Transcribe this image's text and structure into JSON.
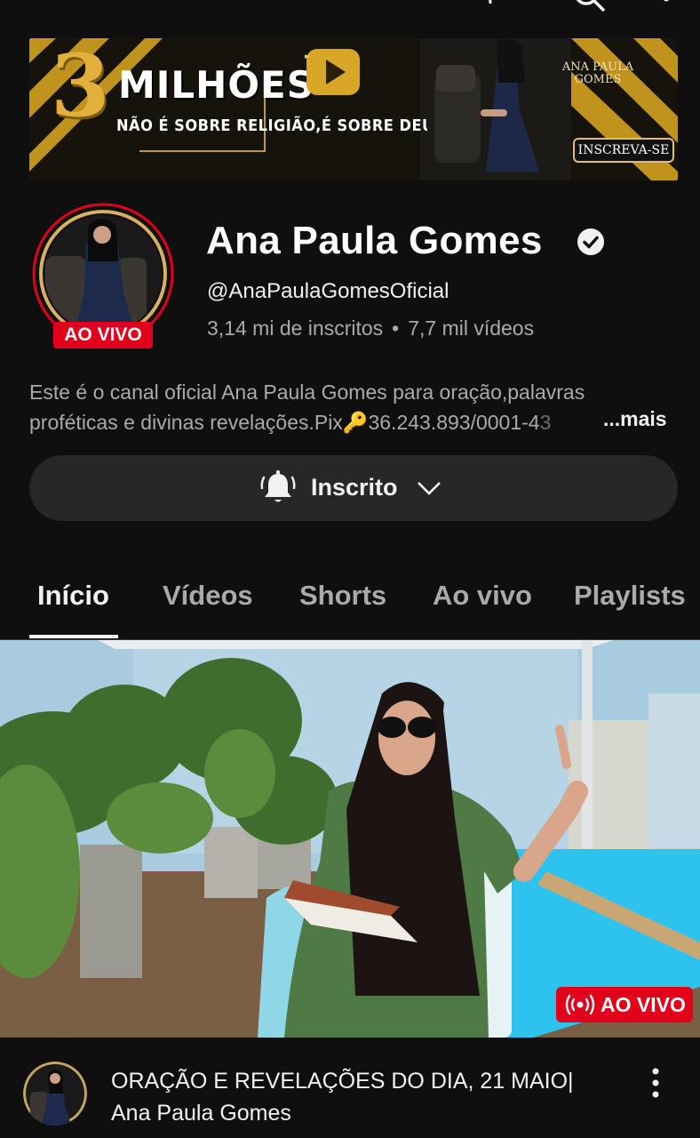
{
  "banner": {
    "big_number": "3",
    "headline": "MILHÕES",
    "tagline": "NÃO É SOBRE RELIGIÃO,É SOBRE DEUS.",
    "name_line1": "ANA PAULA",
    "name_line2": "GOMES",
    "cta": "INSCREVA-SE"
  },
  "channel": {
    "name": "Ana Paula Gomes",
    "handle": "@AnaPaulaGomesOficial",
    "subscribers": "3,14 mi de inscritos",
    "separator": "•",
    "videos": "7,7 mil vídeos",
    "live_badge": "AO VIVO",
    "description_line1": "Este é o canal oficial Ana Paula Gomes para oração,palavras",
    "description_line2": "proféticas e divinas revelações.Pix🔑36.243.893/0001-4",
    "description_fade": "3",
    "more": "...mais"
  },
  "subscribe": {
    "label": "Inscrito"
  },
  "tabs": [
    {
      "label": "Início",
      "active": true
    },
    {
      "label": "Vídeos",
      "active": false
    },
    {
      "label": "Shorts",
      "active": false
    },
    {
      "label": "Ao vivo",
      "active": false
    },
    {
      "label": "Playlists",
      "active": false
    }
  ],
  "video": {
    "live_label": "AO VIVO",
    "title_line1": "ORAÇÃO E REVELAÇÕES DO DIA, 21 MAIO|",
    "title_line2": "Ana Paula Gomes"
  },
  "colors": {
    "background": "#0f0f0f",
    "live_red": "#e3001b",
    "button_bg": "#272727",
    "banner_gold": "#e2b13c"
  },
  "icons": [
    "back-arrow-icon",
    "cast-icon",
    "search-icon",
    "more-vert-icon",
    "verified-icon",
    "bell-icon",
    "chevron-down-icon",
    "live-waves-icon"
  ]
}
